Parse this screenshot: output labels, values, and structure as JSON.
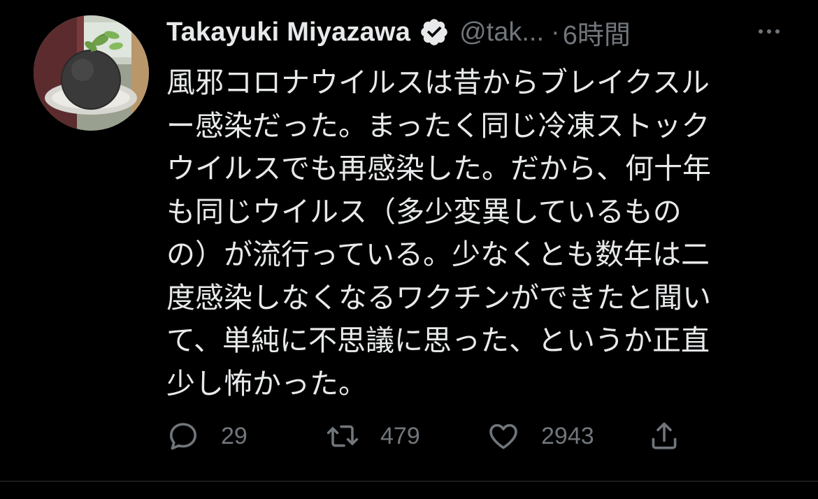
{
  "author": {
    "display_name": "Takayuki Miyazawa",
    "handle": "@tak...",
    "separator": "·",
    "timestamp": "6時間"
  },
  "tweet": {
    "lines": [
      "風邪コロナウイルスは昔からブレイクスル",
      "ー感染だった。まったく同じ冷凍ストック",
      "ウイルスでも再感染した。だから、何十年",
      "も同じウイルス（多少変異しているもの",
      "の）が流行っている。少なくとも数年は二",
      "度感染しなくなるワクチンができたと聞い",
      "て、単純に不思議に思った、というか正直",
      "少し怖かった。"
    ]
  },
  "actions": {
    "reply_count": "29",
    "retweet_count": "479",
    "like_count": "2943"
  },
  "icons": {
    "verified": "verified-badge-icon",
    "more": "more-icon",
    "reply": "reply-icon",
    "retweet": "retweet-icon",
    "like": "heart-icon",
    "share": "share-icon"
  },
  "colors": {
    "background": "#000000",
    "text_primary": "#e7e9ea",
    "text_secondary": "#71767b",
    "divider": "#2f3336"
  }
}
